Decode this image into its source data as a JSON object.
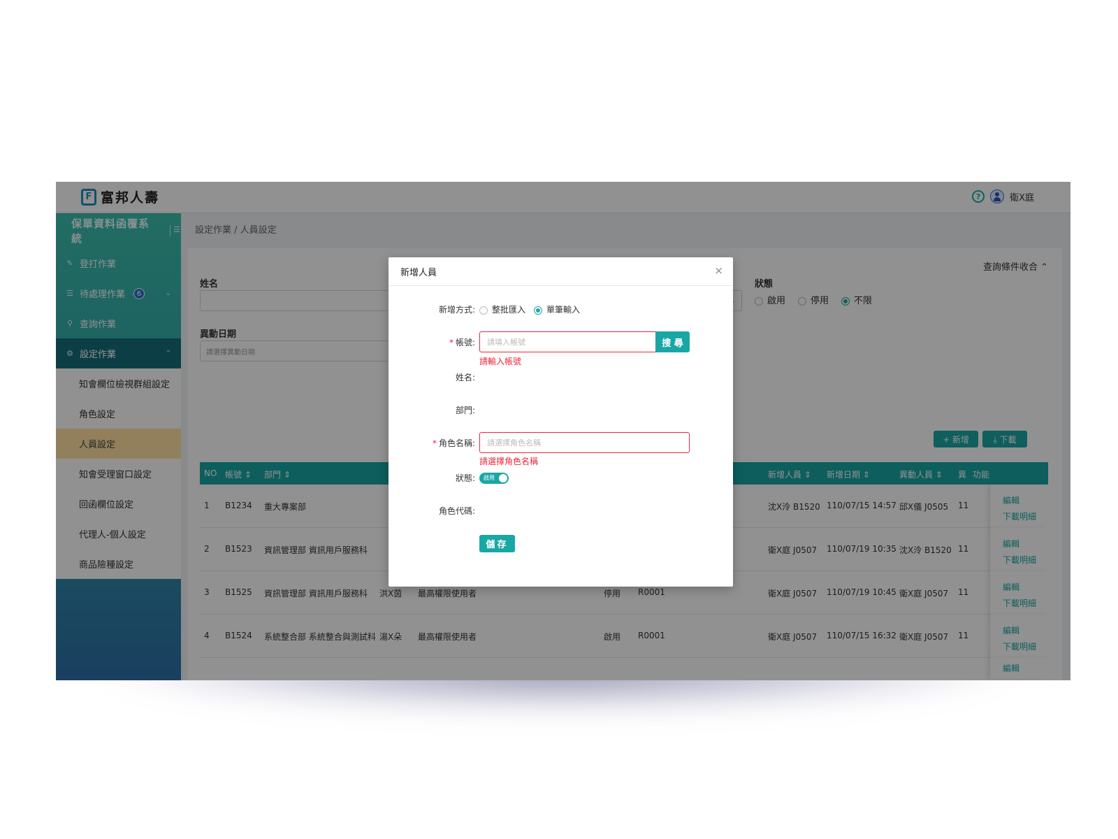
{
  "header": {
    "logo_mark": "F",
    "logo_text": "富邦人壽",
    "help_glyph": "?",
    "user_name": "衛X庭"
  },
  "sidebar": {
    "title": "保單資料函覆系統",
    "collapse_glyph": "☰",
    "items": [
      {
        "label": "登打作業",
        "icon": "edit-icon"
      },
      {
        "label": "待處理作業",
        "icon": "list-icon",
        "badge": "6"
      },
      {
        "label": "查詢作業",
        "icon": "search-icon"
      },
      {
        "label": "設定作業",
        "icon": "gear-icon"
      }
    ],
    "sub_items": [
      "知會欄位檢視群組設定",
      "角色設定",
      "人員設定",
      "知會受理窗口設定",
      "回函欄位設定",
      "代理人-個人設定",
      "商品險種設定"
    ]
  },
  "breadcrumb": "設定作業 / 人員設定",
  "search_form": {
    "name_label": "姓名",
    "date_label": "異動日期",
    "date_placeholder": "請選擇異動日期",
    "status_label": "狀態",
    "status_options": [
      "啟用",
      "停用",
      "不限"
    ],
    "collapse_label": "查詢條件收合"
  },
  "actions": {
    "add_label": "+ 新增",
    "download_label": "⤓ 下載"
  },
  "table": {
    "headers": {
      "no": "NO",
      "account": "帳號 ⇕",
      "dept": "部門 ⇕",
      "creator": "新增人員 ⇕",
      "created": "新增日期 ⇕",
      "modifier": "異動人員 ⇕",
      "modified": "異",
      "func": "功能"
    },
    "rows": [
      {
        "no": "1",
        "account": "B1234",
        "dept": "重大專案部",
        "name": "",
        "role": "",
        "status": "",
        "code": "",
        "creator": "沈X泠 B1520",
        "created": "110/07/15 14:57",
        "modifier": "邱X儀 J0505",
        "modified": "11"
      },
      {
        "no": "2",
        "account": "B1523",
        "dept": "資訊管理部 資訊用戶服務科",
        "name": "",
        "role": "",
        "status": "",
        "code": "",
        "creator": "衛X庭 J0507",
        "created": "110/07/19 10:35",
        "modifier": "沈X泠 B1520",
        "modified": "11"
      },
      {
        "no": "3",
        "account": "B1525",
        "dept": "資訊管理部 資訊用戶服務科",
        "name": "洪X茵",
        "role": "最高權限使用者",
        "status": "停用",
        "code": "R0001",
        "creator": "衛X庭 J0507",
        "created": "110/07/19 10:45",
        "modifier": "衛X庭 J0507",
        "modified": "11"
      },
      {
        "no": "4",
        "account": "B1524",
        "dept": "系統整合部 系統整合與測試科",
        "name": "湯X朵",
        "role": "最高權限使用者",
        "status": "啟用",
        "code": "R0001",
        "creator": "衛X庭 J0507",
        "created": "110/07/15 16:32",
        "modifier": "衛X庭 J0507",
        "modified": "11"
      }
    ],
    "edit_label": "編輯",
    "download_detail_label": "下載明細",
    "partial_edit_label": "編輯"
  },
  "modal": {
    "title": "新增人員",
    "close_glyph": "×",
    "method_label": "新增方式:",
    "method_options": [
      "整批匯入",
      "單筆輸入"
    ],
    "method_selected": "單筆輸入",
    "account_label": "帳號:",
    "account_placeholder": "請填入帳號",
    "search_label": "搜 尋",
    "account_error": "請輸入帳號",
    "name_label": "姓名:",
    "dept_label": "部門:",
    "role_label": "角色名稱:",
    "role_placeholder": "請選擇角色名稱",
    "role_error": "請選擇角色名稱",
    "status_label": "狀態:",
    "status_toggle_text": "啟用",
    "role_code_label": "角色代碼:",
    "save_label": "儲存"
  },
  "colors": {
    "accent": "#19a7a5",
    "error": "#e8283c",
    "selected_nav": "#ffe2a0"
  }
}
